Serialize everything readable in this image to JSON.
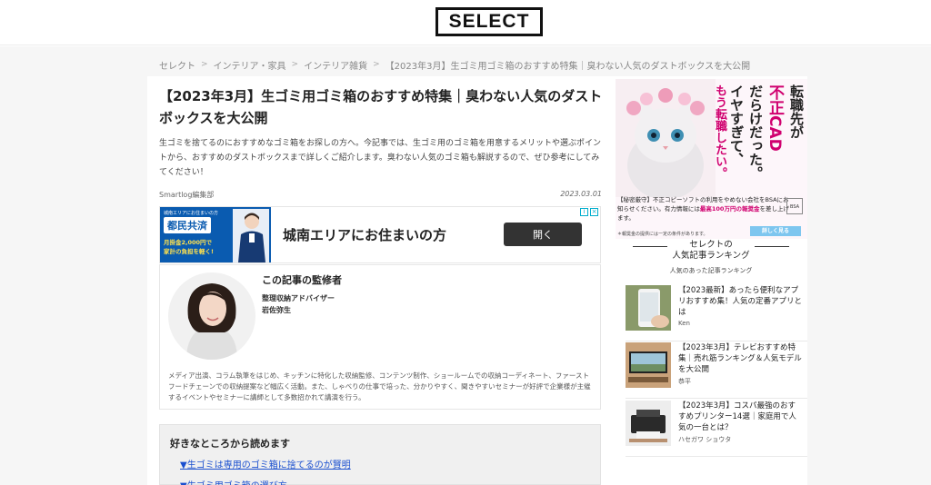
{
  "header": {
    "logo_text": "SELECT"
  },
  "breadcrumb": [
    "セレクト",
    "インテリア・家具",
    "インテリア雑貨",
    "【2023年3月】生ゴミ用ゴミ箱のおすすめ特集｜臭わない人気のダストボックスを大公開"
  ],
  "article": {
    "title": "【2023年3月】生ゴミ用ゴミ箱のおすすめ特集｜臭わない人気のダストボックスを大公開",
    "lead": "生ゴミを捨てるのにおすすめなゴミ箱をお探しの方へ。今記事では、生ゴミ用のゴミ箱を用意するメリットや選ぶポイントから、おすすめのダストボックスまで詳しくご紹介します。臭わない人気のゴミ箱も解説するので、ぜひ参考にしてみてください！",
    "author": "Smartlog編集部",
    "date": "2023.03.01"
  },
  "ad_banner": {
    "small_text": "城南エリアにお住まいの方",
    "brand": "都民共済",
    "promo_line1": "月掛金2,000円で",
    "promo_line2": "家計の負担を軽く!",
    "headline": "城南エリアにお住まいの方",
    "button": "開く"
  },
  "supervisor": {
    "heading": "この記事の監修者",
    "role": "整理収納アドバイザー",
    "name": "岩佐弥生",
    "description": "メディア出演、コラム執筆をはじめ、キッチンに特化した収納監修、コンテンツ制作、ショールームでの収納コーディネート、ファーストフードチェーンでの収納提案など幅広く活動。また、しゃべりの仕事で培った、分かりやすく、聞きやすいセミナーが好評で企業様が主催するイベントやセミナーに講師として多数招かれて講演を行う。"
  },
  "toc": {
    "heading": "好きなところから読めます",
    "items": [
      "▼生ゴミは専用のゴミ箱に捨てるのが賢明",
      "▼生ゴミ用ゴミ箱の選び方"
    ]
  },
  "side_ad": {
    "col1": "転職先が",
    "col2": "不正CAD",
    "col3": "だらけだった。",
    "col4": "イヤすぎて、",
    "col5": "もう転職したい。",
    "footer": "【秘密厳守】不正コピーソフトの利用をやめない会社をBSAにお知らせください。有力情報には",
    "footer_highlight": "最高100万円の報奨金",
    "footer_end": "を差し上げます。",
    "note": "＊報奨金の提供には一定の条件があります。",
    "button": "詳しく見る",
    "bsa": "BSA"
  },
  "ranking": {
    "title_line1": "セレクトの",
    "title_line2": "人気記事ランキング",
    "subtitle": "人気のあった記事ランキング",
    "items": [
      {
        "title": "【2023最新】あったら便利なアプリおすすめ集！人気の定番アプリとは",
        "author": "Ken"
      },
      {
        "title": "【2023年3月】テレビおすすめ特集｜売れ筋ランキング＆人気モデルを大公開",
        "author": "恭平"
      },
      {
        "title": "【2023年3月】コスパ最強のおすすめプリンター14選｜家庭用で人気の一台とは？",
        "author": "ハセガワ ショウタ"
      }
    ]
  },
  "colors": {
    "link": "#1a4fcf",
    "ad_blue": "#0a5bb0",
    "accent_pink": "#d0006f"
  }
}
